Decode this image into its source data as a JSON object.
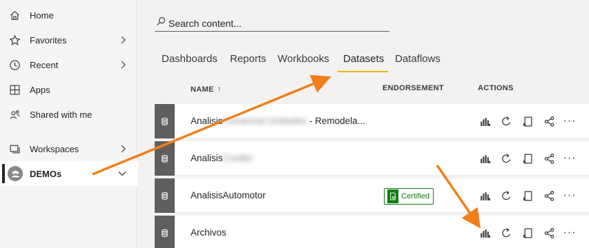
{
  "sidebar": {
    "items": [
      {
        "label": "Home",
        "icon": "home-icon"
      },
      {
        "label": "Favorites",
        "icon": "star-icon",
        "chevron": "right"
      },
      {
        "label": "Recent",
        "icon": "clock-icon",
        "chevron": "right"
      },
      {
        "label": "Apps",
        "icon": "apps-icon"
      },
      {
        "label": "Shared with me",
        "icon": "shared-people-icon"
      },
      {
        "label": "Workspaces",
        "icon": "workspaces-icon",
        "chevron": "right"
      },
      {
        "label": "DEMOs",
        "icon": "workspace-avatar-icon",
        "chevron": "down",
        "active": true
      }
    ]
  },
  "search": {
    "placeholder": "Search content..."
  },
  "tabs": [
    {
      "label": "Dashboards"
    },
    {
      "label": "Reports"
    },
    {
      "label": "Workbooks"
    },
    {
      "label": "Datasets",
      "active": true
    },
    {
      "label": "Dataflows"
    }
  ],
  "table": {
    "headers": {
      "name": "NAME",
      "sort": "↑",
      "endorsement": "ENDORSEMENT",
      "actions": "ACTIONS"
    },
    "rows": [
      {
        "name_prefix": "Analisis",
        "name_blurred": "Comercial Unidades",
        "name_suffix": " - Remodela...",
        "endorsement": ""
      },
      {
        "name_prefix": "Analisis",
        "name_blurred": "Credito",
        "name_suffix": "",
        "endorsement": ""
      },
      {
        "name_prefix": "AnalisisAutomotor",
        "name_blurred": "",
        "name_suffix": "",
        "endorsement": "Certified"
      },
      {
        "name_prefix": "Archivos",
        "name_blurred": "",
        "name_suffix": "",
        "endorsement": ""
      }
    ],
    "more": "···"
  },
  "colors": {
    "accent": "#e8b60a",
    "annotation": "#f07f1a",
    "certified": "#107c10",
    "row_icon_bg": "#605e5c"
  }
}
